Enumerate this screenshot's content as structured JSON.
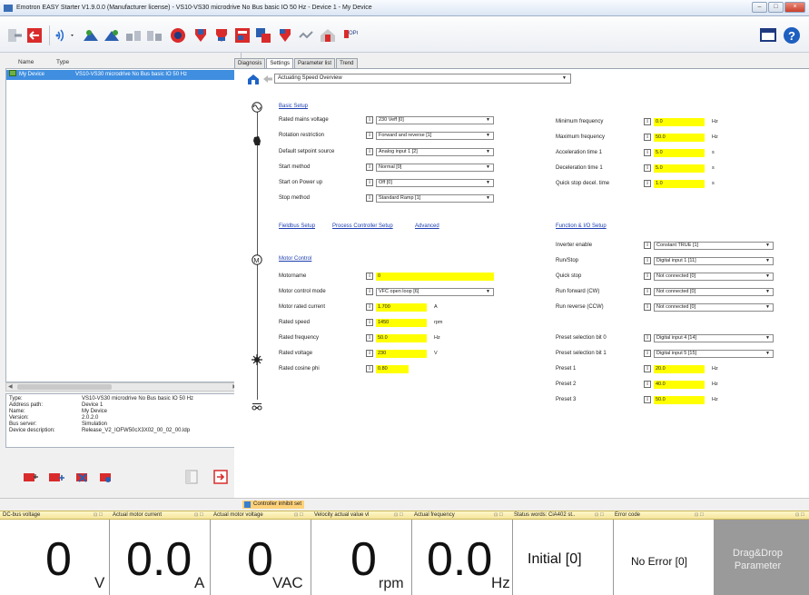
{
  "window": {
    "title": "Emotron EASY Starter V1.9.0.0 (Manufacturer license) - VS10-VS30 microdrive No Bus basic IO 50 Hz - Device 1 - My Device",
    "controls": [
      "–",
      "□",
      "×"
    ]
  },
  "tree": {
    "col_name": "Name",
    "col_type": "Type",
    "rows": [
      {
        "name": "My Device",
        "type": "VS10-VS30 microdrive No Bus basic IO 50 Hz"
      }
    ]
  },
  "properties": [
    {
      "label": "Type:",
      "value": "VS10-VS30 microdrive No Bus basic IO 50 Hz"
    },
    {
      "label": "Address path:",
      "value": "Device 1"
    },
    {
      "label": "Name:",
      "value": "My Device"
    },
    {
      "label": "Version:",
      "value": "2.0.2.0"
    },
    {
      "label": "Bus server:",
      "value": "Simulation"
    },
    {
      "label": "Device description:",
      "value": "Release_V2_IOFW50cX3X02_00_02_00.ldp"
    }
  ],
  "tabs": [
    "Diagnosis",
    "Settings",
    "Parameter list",
    "Trend"
  ],
  "active_tab": "Settings",
  "nav_select": "Actuating Speed Overview",
  "basic_setup": {
    "title": "Basic Setup",
    "rows": [
      {
        "label": "Rated mains voltage",
        "value": "230 Veff [0]"
      },
      {
        "label": "Rotation restriction",
        "value": "Forward and reverse [1]"
      },
      {
        "label": "Default setpoint source",
        "value": "Analog input 1 [2]"
      },
      {
        "label": "Start method",
        "value": "Normal [0]"
      },
      {
        "label": "Start on Power up",
        "value": "Off [0]"
      },
      {
        "label": "Stop method",
        "value": "Standard Ramp [1]"
      }
    ],
    "right_rows": [
      {
        "label": "Minimum frequency",
        "value": "0.0",
        "unit": "Hz"
      },
      {
        "label": "Maximum frequency",
        "value": "50.0",
        "unit": "Hz"
      },
      {
        "label": "Acceleration time 1",
        "value": "5.0",
        "unit": "s"
      },
      {
        "label": "Deceleration time 1",
        "value": "5.0",
        "unit": "s"
      },
      {
        "label": "Quick stop decel. time",
        "value": "1.0",
        "unit": "s"
      }
    ]
  },
  "links": {
    "fieldbus": "Fieldbus Setup",
    "process": "Process Controller Setup",
    "advanced": "Advanced",
    "function_io": "Function & I/O Setup"
  },
  "io_setup": [
    {
      "label": "Inverter enable",
      "value": "Constant TRUE [1]"
    },
    {
      "label": "Run/Stop",
      "value": "Digital input 1 [11]"
    },
    {
      "label": "Quick stop",
      "value": "Not connected [0]"
    },
    {
      "label": "Run forward (CW)",
      "value": "Not connected [0]"
    },
    {
      "label": "Run reverse (CCW)",
      "value": "Not connected [0]"
    },
    {
      "label": "Preset selection bit 0",
      "value": "Digital input 4 [14]"
    },
    {
      "label": "Preset selection bit 1",
      "value": "Digital input 5 [15]"
    }
  ],
  "presets": [
    {
      "label": "Preset 1",
      "value": "20.0",
      "unit": "Hz"
    },
    {
      "label": "Preset 2",
      "value": "40.0",
      "unit": "Hz"
    },
    {
      "label": "Preset 3",
      "value": "50.0",
      "unit": "Hz"
    }
  ],
  "motor_control": {
    "title": "Motor Control",
    "motorname_label": "Motorname",
    "motorname_value": "0",
    "mode_label": "Motor control mode",
    "mode_value": "VFC open loop [6]",
    "rows": [
      {
        "label": "Motor rated current",
        "value": "1.700",
        "unit": "A"
      },
      {
        "label": "Rated speed",
        "value": "1450",
        "unit": "rpm"
      },
      {
        "label": "Rated frequency",
        "value": "50.0",
        "unit": "Hz"
      },
      {
        "label": "Rated voltage",
        "value": "230",
        "unit": "V"
      },
      {
        "label": "Rated cosine phi",
        "value": "0.80",
        "unit": ""
      }
    ]
  },
  "info_button": "I",
  "dropdown_arrow": "▼",
  "status": {
    "inhibit": "Controller inhibit set"
  },
  "monitor_pin": "⊡ ☐",
  "monitors": [
    {
      "header": "DC-bus voltage",
      "value": "0",
      "unit": "V"
    },
    {
      "header": "Actual motor current",
      "value": "0.0",
      "unit": "A"
    },
    {
      "header": "Actual motor voltage",
      "value": "0",
      "unit": "VAC"
    },
    {
      "header": "Velocity actual value vl",
      "value": "0",
      "unit": "rpm"
    },
    {
      "header": "Actual frequency",
      "value": "0.0",
      "unit": "Hz"
    },
    {
      "header": "Status words: CiA402 st..",
      "value": "Initial [0]",
      "unit": ""
    },
    {
      "header": "Error code",
      "value": "No Error [0]",
      "unit": ""
    },
    {
      "header": "",
      "value": "Drag&Drop\nParameter",
      "unit": ""
    }
  ],
  "colors": {
    "highlight_field": "#ffff00",
    "selection": "#3f8ee0",
    "link": "#1e3fb0",
    "inhibit_bar": "#ffd27a"
  }
}
